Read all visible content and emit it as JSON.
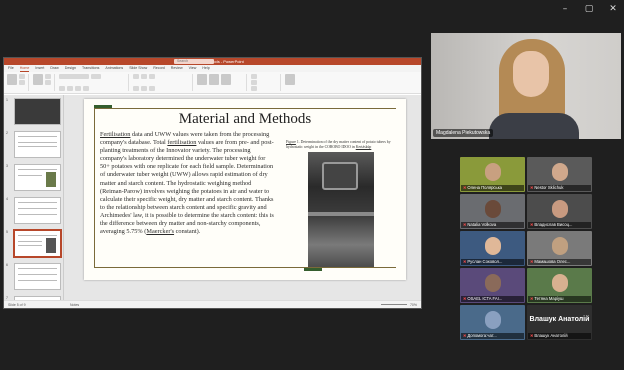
{
  "window_controls": {
    "minimize": "–",
    "maximize": "▢",
    "close": "✕"
  },
  "ppt": {
    "title": "Material and Methods - PowerPoint",
    "search_placeholder": "Search",
    "tabs": [
      "File",
      "Home",
      "Insert",
      "Draw",
      "Design",
      "Transitions",
      "Animations",
      "Slide Show",
      "Record",
      "Review",
      "View",
      "Help"
    ],
    "active_tab": "Home",
    "status_left": "Slide 5 of 9",
    "notes_label": "Notes",
    "zoom": "70%"
  },
  "slide": {
    "title": "Material and Methods",
    "body_parts": {
      "p1": "Fertilisation",
      "p2": " data and UWW values were taken from the processing company's database. Total ",
      "p3": "fertilisation",
      "p4": " values are from pre- and post-planting treatments of the Innovator variety. The processing company's laboratory determined the underwater tuber weight for 50+ potatoes with one replicate for each field sample. Determination of underwater tuber weight (UWW) allows rapid estimation of dry matter and starch content. The hydrostatic weighing method (Reiman-Parow) involves weighing the potatoes in air and water to calculate their specific weight, dry matter and starch content. Thanks to the relationship between starch content and specific gravity and Archimedes' law, it is possible to determine the starch content: this is the difference between dry matter and non-starchy components, averaging 5.75% (",
      "p5": "Maercker's",
      "p6": " constant)."
    },
    "caption_parts": {
      "c1": "Figure",
      "c2": " 1. Determination of the dry matter content of potato tubers by hydrostatic weight in the COROBO IDOO in ",
      "c3": "Kertáskúp"
    }
  },
  "main_participant": {
    "name": "Magdalena Piekutowska"
  },
  "participants": [
    {
      "name": "Олена Полярська",
      "bg": "#8a9a3a",
      "avatar": "#c8a080",
      "muted": true
    },
    {
      "name": "Nestor Sklichuk",
      "bg": "#5a5a5a",
      "avatar": "#d0a88c",
      "muted": true
    },
    {
      "name": "Natalia Volkova",
      "bg": "#6a6c70",
      "avatar": "#6a4a3a",
      "muted": true
    },
    {
      "name": "Владислав Висоц...",
      "bg": "#4c4c4c",
      "avatar": "#c89a80",
      "muted": true
    },
    {
      "name": "Руслан Соковол...",
      "bg": "#3d5a80",
      "avatar": "#e0b898",
      "muted": true
    },
    {
      "name": "Мамашова Олес...",
      "bg": "#7a7a7a",
      "avatar": "#c0a080",
      "muted": true
    },
    {
      "name": "OSAEL ICTA FAI...",
      "bg": "#5a4a7a",
      "avatar": "#8a6a5a",
      "muted": true
    },
    {
      "name": "Тетяна Маріуш",
      "bg": "#5a7a4a",
      "avatar": "#d8b090",
      "muted": true
    },
    {
      "name": "Допомога:чат...",
      "bg": "#4a6a8a",
      "avatar": "#8aa0c0",
      "muted": true
    },
    {
      "name": "Влашук Анатолій",
      "bg": "#2f2f2f",
      "avatar": "",
      "muted": true,
      "big_name": "Влашук Анатолій"
    }
  ]
}
